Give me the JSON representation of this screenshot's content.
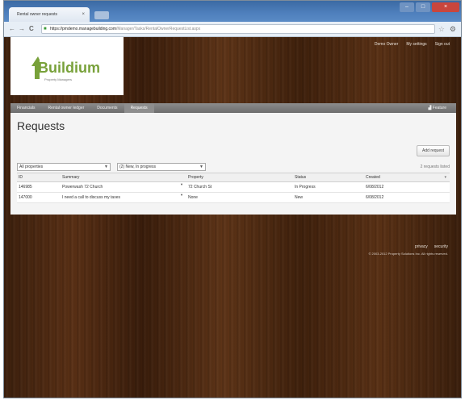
{
  "browser": {
    "tab_title": "Rental owner requests",
    "tab_close": "×",
    "url_host": "https://pmdemo.managebuilding.com",
    "url_path": "/Manager/Tasks/RentalOwnerRequestList.aspx",
    "window_minimize": "–",
    "window_maximize": "□",
    "window_close": "×",
    "back": "←",
    "forward": "→",
    "reload": "C",
    "star": "☆",
    "wrench": "🔧"
  },
  "logo": {
    "name": "Buildium",
    "sub": "Property Managers",
    "brand_color": "#78a13a"
  },
  "user_links": [
    "Demo Owner",
    "My settings",
    "Sign out"
  ],
  "nav": {
    "items": [
      "Financials",
      "Rental owner ledger",
      "Documents",
      "Requests"
    ],
    "active": "Requests",
    "feature": "Feature"
  },
  "main": {
    "title": "Requests",
    "add_button": "Add request",
    "filter_property": "All properties",
    "filter_status": "(2) New, In progress",
    "count_text": "2 requests listed"
  },
  "table": {
    "headers": [
      "ID",
      "Summary",
      "Property",
      "Status",
      "Created"
    ],
    "rows": [
      [
        "146985",
        "Powerwash 72 Church",
        "72 Church St",
        "In Progress",
        "6/08/2012"
      ],
      [
        "147000",
        "I need a call to discuss my taxes",
        "None",
        "New",
        "6/08/2012"
      ]
    ]
  },
  "footer": {
    "links": [
      "privacy",
      "security"
    ],
    "copyright": "© 2003-2012 Property Solutions Inc. All rights reserved."
  }
}
